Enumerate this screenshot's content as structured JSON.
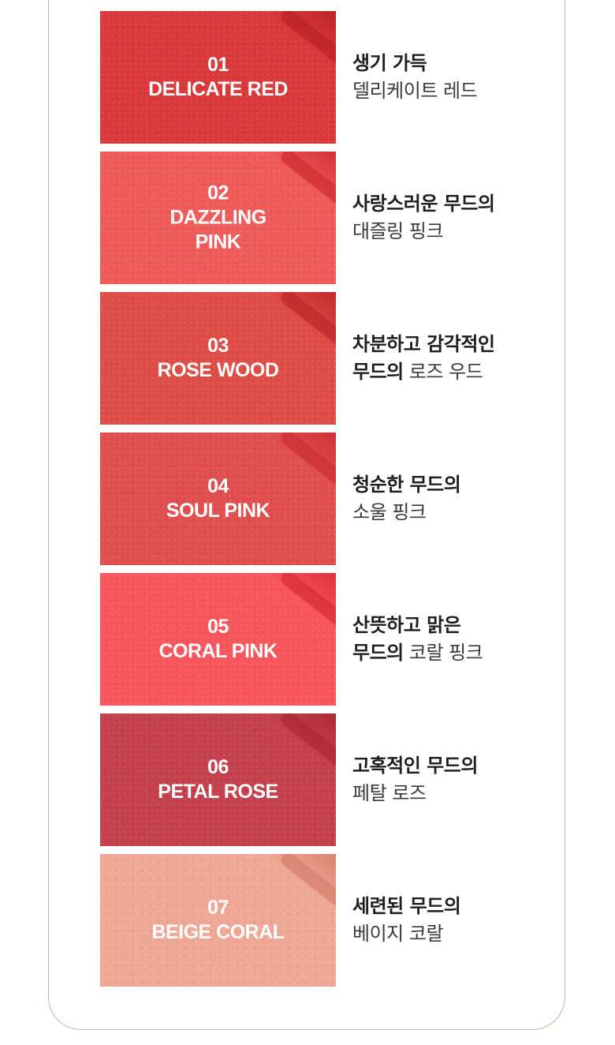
{
  "shades": [
    {
      "number": "01",
      "name_lines": [
        "DELICATE RED"
      ],
      "desc_line1_bold": "생기 가득",
      "desc_line2_bold": "",
      "desc_line2_thin": "델리케이트 레드",
      "color": "#d9393a",
      "streak_color": "#b31d22"
    },
    {
      "number": "02",
      "name_lines": [
        "DAZZLING",
        "PINK"
      ],
      "desc_line1_bold": "사랑스러운 무드의",
      "desc_line2_bold": "",
      "desc_line2_thin": "대즐링 핑크",
      "color": "#ef5b58",
      "streak_color": "#c8202a"
    },
    {
      "number": "03",
      "name_lines": [
        "ROSE WOOD"
      ],
      "desc_line1_bold": "차분하고 감각적인",
      "desc_line2_bold": "무드의",
      "desc_line2_thin": "로즈 우드",
      "color": "#dd4d45",
      "streak_color": "#b51e22"
    },
    {
      "number": "04",
      "name_lines": [
        "SOUL PINK"
      ],
      "desc_line1_bold": "청순한 무드의",
      "desc_line2_bold": "",
      "desc_line2_thin": "소울 핑크",
      "color": "#e04e4f",
      "streak_color": "#c7282f"
    },
    {
      "number": "05",
      "name_lines": [
        "CORAL PINK"
      ],
      "desc_line1_bold": "산뜻하고 맑은",
      "desc_line2_bold": "무드의",
      "desc_line2_thin": "코랄 핑크",
      "color": "#f8565d",
      "streak_color": "#d42330"
    },
    {
      "number": "06",
      "name_lines": [
        "PETAL ROSE"
      ],
      "desc_line1_bold": "고혹적인 무드의",
      "desc_line2_bold": "",
      "desc_line2_thin": "페탈 로즈",
      "color": "#c3404c",
      "streak_color": "#a52230"
    },
    {
      "number": "07",
      "name_lines": [
        "BEIGE CORAL"
      ],
      "desc_line1_bold": "세련된 무드의",
      "desc_line2_bold": "",
      "desc_line2_thin": "베이지 코랄",
      "color": "#efa796",
      "streak_color": "#d07864"
    }
  ]
}
